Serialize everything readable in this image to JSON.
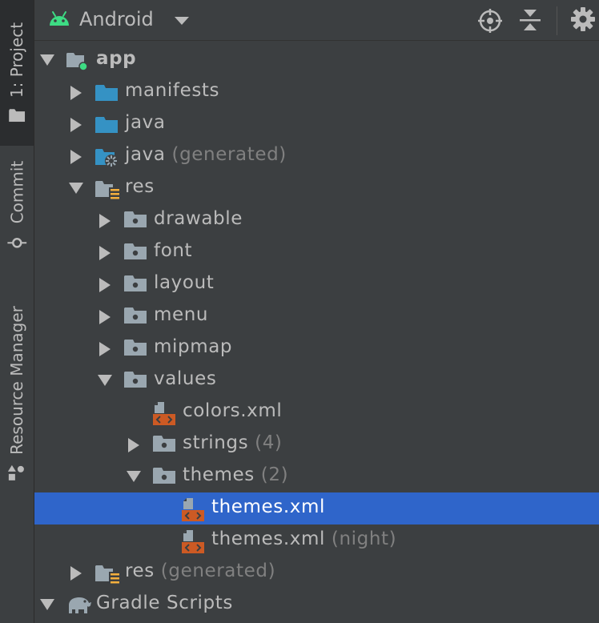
{
  "sidebar": {
    "tabs": [
      {
        "label": "1: Project",
        "active": true
      },
      {
        "label": "Commit",
        "active": false
      },
      {
        "label": "Resource Manager",
        "active": false
      }
    ]
  },
  "toolbar": {
    "view": "Android",
    "icons": [
      "android-icon",
      "dropdown-arrow-icon",
      "locate-icon",
      "collapse-all-icon",
      "settings-gear-icon"
    ]
  },
  "tree": [
    {
      "label": "app",
      "suffix": "",
      "level": 0,
      "arrow": "expanded",
      "icon": "module-folder-icon",
      "bold": true
    },
    {
      "label": "manifests",
      "suffix": "",
      "level": 1,
      "arrow": "collapsed",
      "icon": "source-folder-icon"
    },
    {
      "label": "java",
      "suffix": "",
      "level": 1,
      "arrow": "collapsed",
      "icon": "source-folder-icon"
    },
    {
      "label": "java",
      "suffix": " (generated)",
      "level": 1,
      "arrow": "collapsed",
      "icon": "generated-source-folder-icon"
    },
    {
      "label": "res",
      "suffix": "",
      "level": 1,
      "arrow": "expanded",
      "icon": "resource-folder-icon"
    },
    {
      "label": "drawable",
      "suffix": "",
      "level": 2,
      "arrow": "collapsed",
      "icon": "folder-icon"
    },
    {
      "label": "font",
      "suffix": "",
      "level": 2,
      "arrow": "collapsed",
      "icon": "folder-icon"
    },
    {
      "label": "layout",
      "suffix": "",
      "level": 2,
      "arrow": "collapsed",
      "icon": "folder-icon"
    },
    {
      "label": "menu",
      "suffix": "",
      "level": 2,
      "arrow": "collapsed",
      "icon": "folder-icon"
    },
    {
      "label": "mipmap",
      "suffix": "",
      "level": 2,
      "arrow": "collapsed",
      "icon": "folder-icon"
    },
    {
      "label": "values",
      "suffix": "",
      "level": 2,
      "arrow": "expanded",
      "icon": "folder-icon"
    },
    {
      "label": "colors.xml",
      "suffix": "",
      "level": 3,
      "arrow": "none",
      "icon": "xml-file-icon"
    },
    {
      "label": "strings",
      "suffix": " (4)",
      "level": 3,
      "arrow": "collapsed",
      "icon": "folder-icon"
    },
    {
      "label": "themes",
      "suffix": " (2)",
      "level": 3,
      "arrow": "expanded",
      "icon": "folder-icon"
    },
    {
      "label": "themes.xml",
      "suffix": "",
      "level": 4,
      "arrow": "none",
      "icon": "xml-file-icon",
      "selected": true
    },
    {
      "label": "themes.xml",
      "suffix": " (night)",
      "level": 4,
      "arrow": "none",
      "icon": "xml-file-icon"
    },
    {
      "label": "res",
      "suffix": " (generated)",
      "level": 1,
      "arrow": "collapsed",
      "icon": "resource-folder-icon"
    },
    {
      "label": "Gradle Scripts",
      "suffix": "",
      "level": 0,
      "arrow": "expanded",
      "icon": "gradle-elephant-icon"
    }
  ],
  "colors": {
    "background": "#3c3f41",
    "selection": "#2f65ca",
    "text": "#bbbbbb",
    "muted_text": "#808080",
    "android_green": "#3ddc84",
    "source_folder_blue": "#3592c4",
    "xml_orange": "#cc5a24"
  }
}
